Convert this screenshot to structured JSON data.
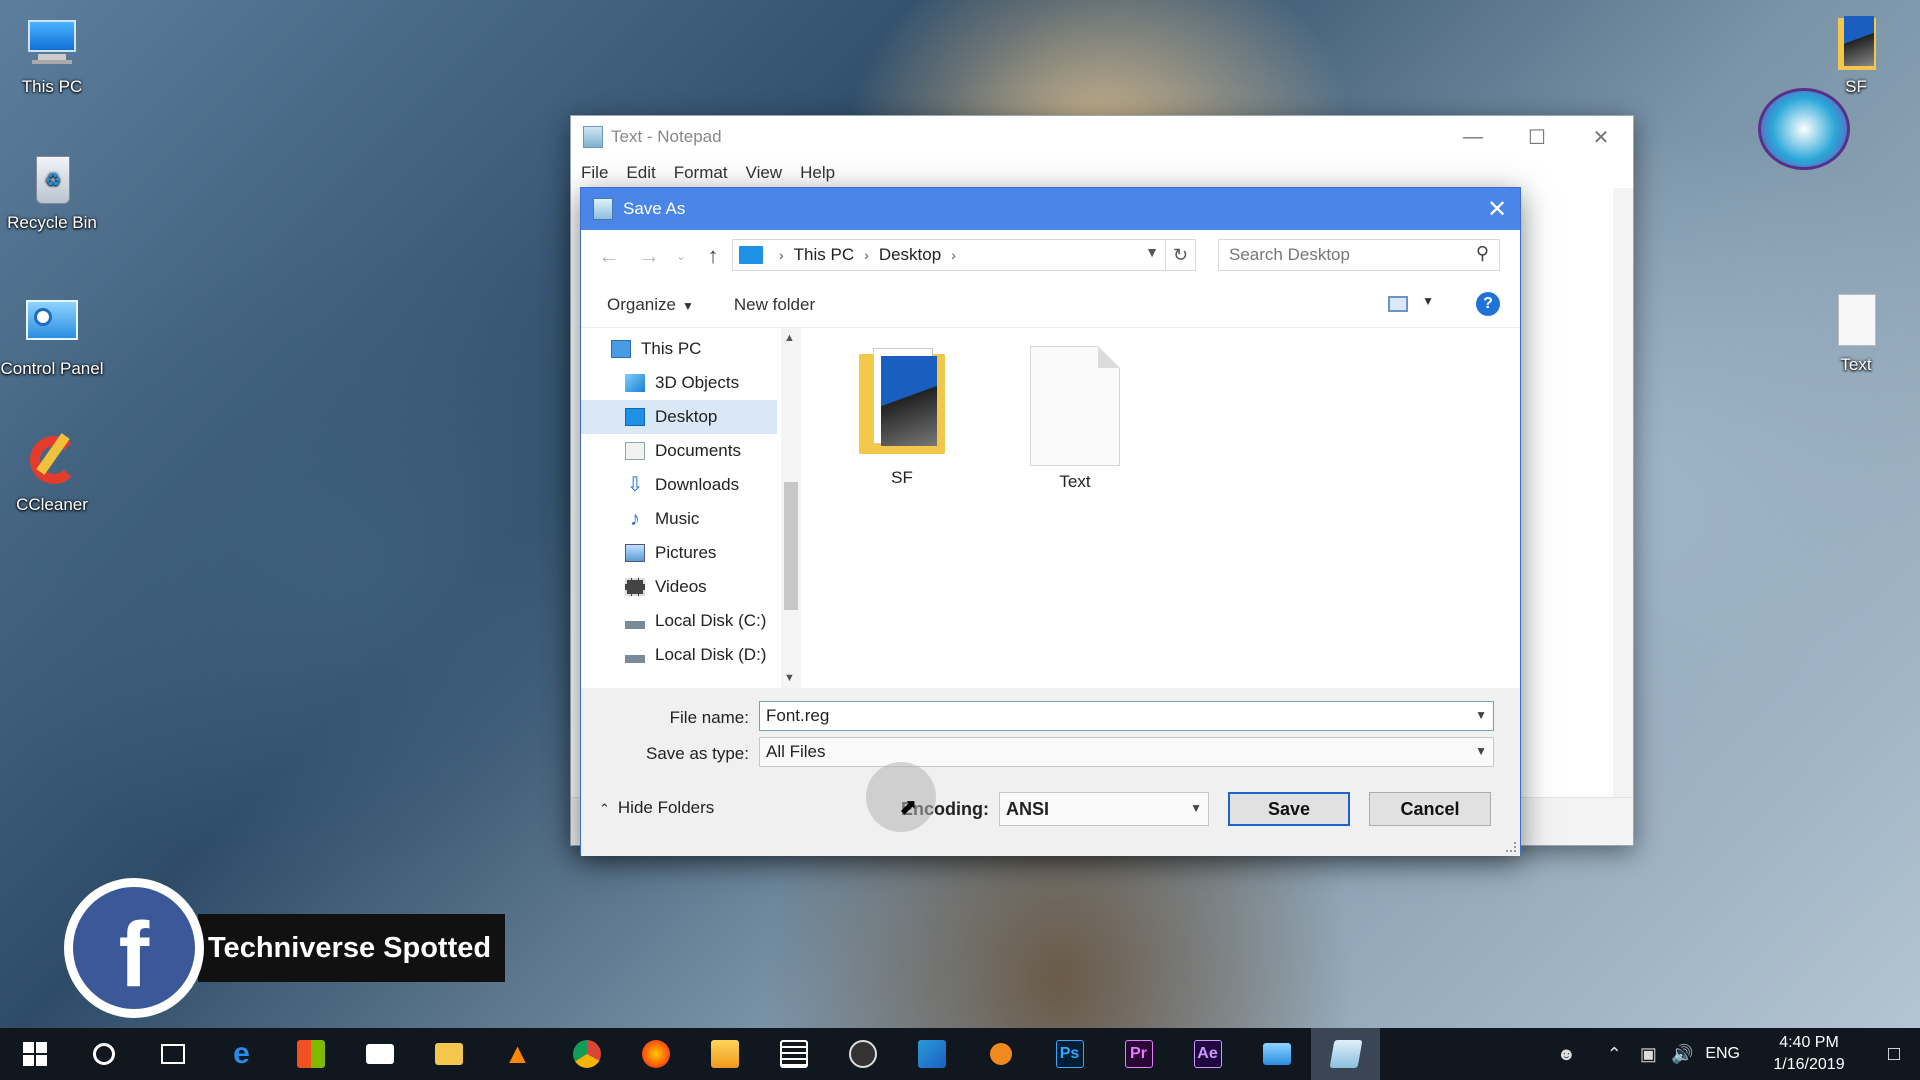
{
  "desktop": {
    "icons": [
      {
        "label": "This PC",
        "icon": "computer-icon"
      },
      {
        "label": "Recycle Bin",
        "icon": "recycle-bin-icon"
      },
      {
        "label": "Control Panel",
        "icon": "control-panel-icon"
      },
      {
        "label": "CCleaner",
        "icon": "ccleaner-icon"
      }
    ],
    "right_icons": [
      {
        "label": "SF",
        "icon": "folder-icon"
      },
      {
        "label": "Text",
        "icon": "text-file-icon"
      }
    ]
  },
  "notepad": {
    "title": "Text - Notepad",
    "menu": [
      "File",
      "Edit",
      "Format",
      "View",
      "Help"
    ]
  },
  "save_dialog": {
    "title": "Save As",
    "breadcrumb": [
      "This PC",
      "Desktop"
    ],
    "search_placeholder": "Search Desktop",
    "toolbar": {
      "organize": "Organize",
      "new_folder": "New folder"
    },
    "tree": [
      {
        "label": "This PC",
        "icon": "computer-icon",
        "selected": false
      },
      {
        "label": "3D Objects",
        "icon": "3d-objects-icon",
        "selected": false
      },
      {
        "label": "Desktop",
        "icon": "desktop-icon",
        "selected": true
      },
      {
        "label": "Documents",
        "icon": "documents-icon",
        "selected": false
      },
      {
        "label": "Downloads",
        "icon": "downloads-icon",
        "selected": false
      },
      {
        "label": "Music",
        "icon": "music-icon",
        "selected": false
      },
      {
        "label": "Pictures",
        "icon": "pictures-icon",
        "selected": false
      },
      {
        "label": "Videos",
        "icon": "videos-icon",
        "selected": false
      },
      {
        "label": "Local Disk (C:)",
        "icon": "drive-icon",
        "selected": false
      },
      {
        "label": "Local Disk (D:)",
        "icon": "drive-icon",
        "selected": false
      }
    ],
    "files": [
      {
        "name": "SF",
        "type": "folder"
      },
      {
        "name": "Text",
        "type": "text-file"
      }
    ],
    "file_name_label": "File name:",
    "file_name_value": "Font.reg",
    "save_type_label": "Save as type:",
    "save_type_value": "All Files",
    "hide_folders": "Hide Folders",
    "encoding_label": "Encoding:",
    "encoding_value": "ANSI",
    "save_button": "Save",
    "cancel_button": "Cancel"
  },
  "overlay": {
    "channel_name": "Techniverse Spotted"
  },
  "taskbar": {
    "apps": [
      "start-icon",
      "cortana-icon",
      "task-view-icon",
      "edge-icon",
      "store-icon",
      "mail-icon",
      "file-explorer-icon",
      "vlc-icon",
      "chrome-icon",
      "firefox-icon",
      "media-player-icon",
      "calculator-icon",
      "obs-icon",
      "camtasia-icon",
      "app-icon",
      "photoshop-icon",
      "premiere-icon",
      "after-effects-icon",
      "control-panel-icon",
      "notepad-icon"
    ],
    "app_labels": {
      "photoshop": "Ps",
      "premiere": "Pr",
      "after_effects": "Ae"
    },
    "language": "ENG",
    "time": "4:40 PM",
    "date": "1/16/2019"
  },
  "colors": {
    "dialog_title": "#4a86e8",
    "taskbar": "#10171f",
    "facebook": "#3b5998"
  }
}
